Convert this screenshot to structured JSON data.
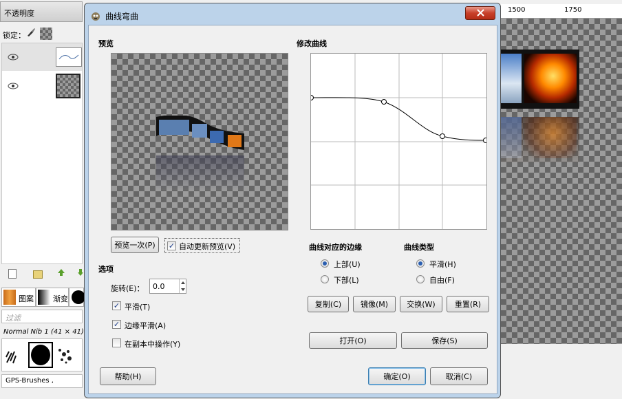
{
  "left_panel": {
    "opacity_label": "不透明度",
    "lock_label": "锁定：",
    "tabs": [
      {
        "label": "图案"
      },
      {
        "label": "渐变"
      }
    ],
    "filter_placeholder": "过滤",
    "brush_name": "Normal Nib 1 (41 × 41)",
    "brush_set": "GPS-Brushes ,"
  },
  "canvas": {
    "ruler_labels": [
      "1500",
      "1750"
    ]
  },
  "dialog": {
    "title": "曲线弯曲",
    "preview": {
      "section_label": "预览",
      "preview_once_button": "预览一次(P)",
      "auto_update_label": "自动更新预览(V)",
      "auto_update_checked": true
    },
    "options": {
      "section_label": "选项",
      "rotate_label": "旋转(E)：",
      "rotate_value": "0.0",
      "smooth_label": "平滑(T)",
      "smooth_checked": true,
      "antialias_label": "边缘平滑(A)",
      "antialias_checked": true,
      "work_on_copy_label": "在副本中操作(Y)",
      "work_on_copy_checked": false
    },
    "curve": {
      "section_label": "修改曲线",
      "edge_label": "曲线对应的边缘",
      "edge_upper": "上部(U)",
      "edge_lower": "下部(L)",
      "edge_selected": "upper",
      "type_label": "曲线类型",
      "type_smooth": "平滑(H)",
      "type_free": "自由(F)",
      "type_selected": "smooth",
      "copy_button": "复制(C)",
      "mirror_button": "镜像(M)",
      "swap_button": "交换(W)",
      "reset_button": "重置(R)",
      "open_button": "打开(O)",
      "save_button": "保存(S)"
    },
    "help_button": "帮助(H)",
    "ok_button": "确定(O)",
    "cancel_button": "取消(C)",
    "close_icon": "close-icon"
  }
}
